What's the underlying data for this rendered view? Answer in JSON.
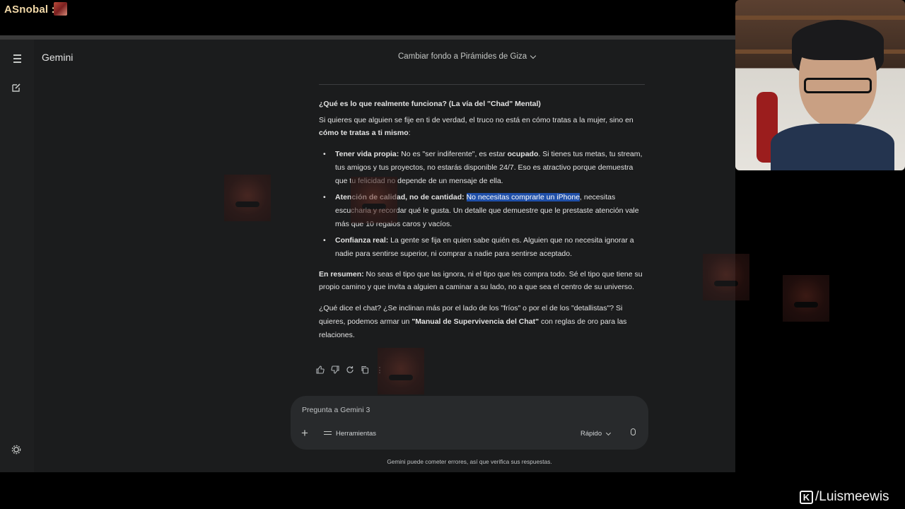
{
  "stream": {
    "username": "ASnobal :",
    "watermark": "/Luismeewis",
    "watermark_logo": "K"
  },
  "app": {
    "brand": "Gemini",
    "chat_title": "Cambiar fondo a Pirámides de Giza"
  },
  "response": {
    "heading": "¿Qué es lo que realmente funciona? (La vía del \"Chad\" Mental)",
    "intro_text": "Si quieres que alguien se fije en ti de verdad, el truco no está en cómo tratas a la mujer, sino en ",
    "intro_bold": "cómo te tratas a ti mismo",
    "intro_end": ":",
    "bullets": [
      {
        "title": "Tener vida propia:",
        "t1": " No es \"ser indiferente\", es estar ",
        "b1": "ocupado",
        "t2": ". Si tienes tus metas, tu stream, tus amigos y tus proyectos, no estarás disponible 24/7. Eso es atractivo porque demuestra que tu felicidad no depende de un mensaje de ella."
      },
      {
        "title": "Atención de calidad, no de cantidad:",
        "highlight": "No necesitas comprarle un iPhone",
        "t1": ", necesitas escucharla y recordar qué le gusta. Un detalle que demuestre que le prestaste atención vale más que 10 regalos caros y vacíos."
      },
      {
        "title": "Confianza real:",
        "t1": " La gente se fija en quien sabe quién es. Alguien que no necesita ignorar a nadie para sentirse superior, ni comprar a nadie para sentirse aceptado."
      }
    ],
    "summary_bold": "En resumen:",
    "summary_text": " No seas el tipo que las ignora, ni el tipo que les compra todo. Sé el tipo que tiene su propio camino y que invita a alguien a caminar a su lado, no a que sea el centro de su universo.",
    "closing_text": "¿Qué dice el chat? ¿Se inclinan más por el lado de los \"fríos\" o por el de los \"detallistas\"? Si quieres, podemos armar un ",
    "closing_bold": "\"Manual de Supervivencia del Chat\"",
    "closing_end": " con reglas de oro para las relaciones."
  },
  "composer": {
    "placeholder": "Pregunta a Gemini 3",
    "tools_label": "Herramientas",
    "mode_label": "Rápido",
    "disclaimer": "Gemini puede cometer errores, así que verifica sus respuestas."
  },
  "icons": [
    "menu-icon",
    "new-chat-icon",
    "settings-icon",
    "thumbs-up-icon",
    "thumbs-down-icon",
    "regenerate-icon",
    "copy-icon",
    "more-icon",
    "plus-icon",
    "tools-icon",
    "chevron-down-icon",
    "mic-icon"
  ],
  "colors": {
    "app_bg": "#1b1c1d",
    "rail_bg": "#1e1f20",
    "composer_bg": "#282a2c",
    "highlight": "#1f4fa8"
  }
}
